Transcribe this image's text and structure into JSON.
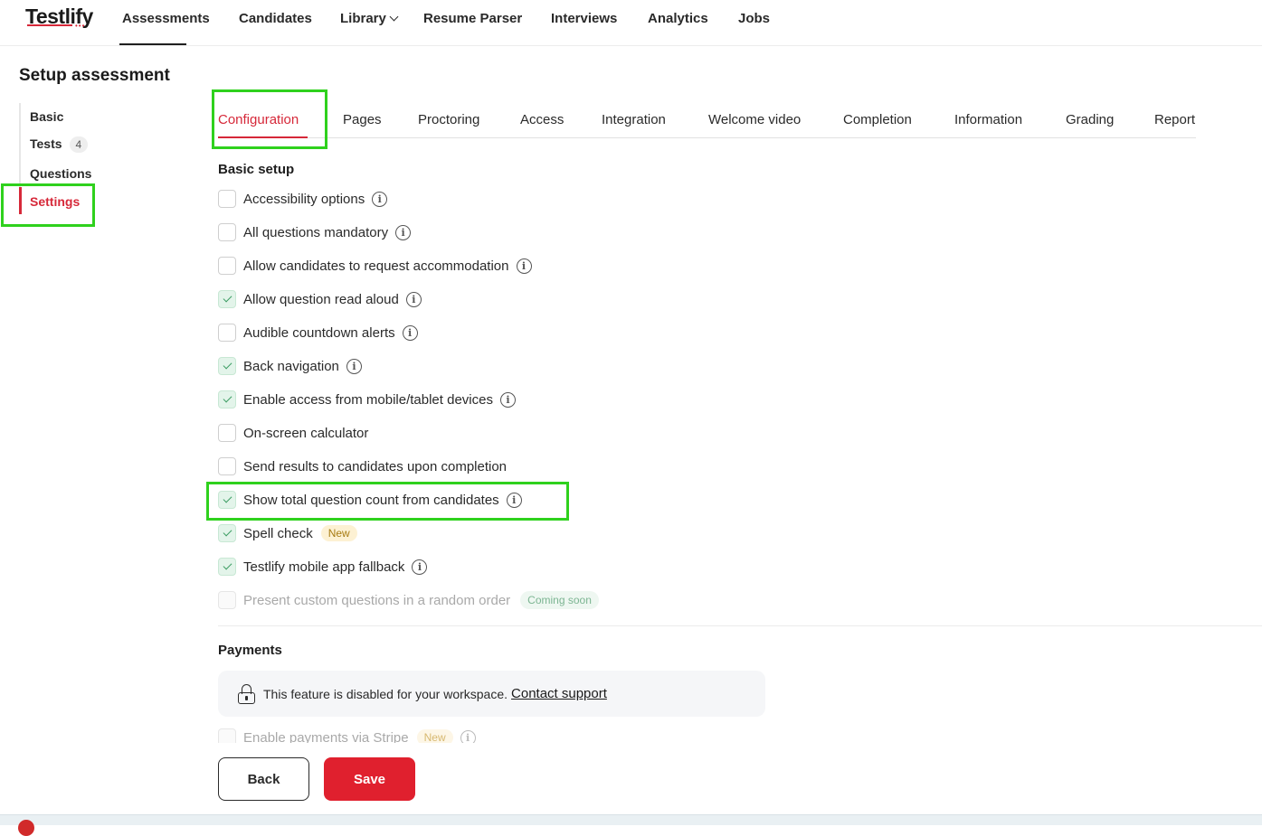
{
  "brand": {
    "logo": "Testlify",
    "logo_dots": "•••"
  },
  "nav": {
    "assessments": "Assessments",
    "candidates": "Candidates",
    "library": "Library",
    "resume_parser": "Resume Parser",
    "interviews": "Interviews",
    "analytics": "Analytics",
    "jobs": "Jobs"
  },
  "page": {
    "title": "Setup assessment"
  },
  "sidebar": {
    "basic": "Basic",
    "tests": "Tests",
    "tests_count": "4",
    "questions": "Questions",
    "settings": "Settings"
  },
  "tabs": {
    "configuration": "Configuration",
    "pages": "Pages",
    "proctoring": "Proctoring",
    "access": "Access",
    "integration": "Integration",
    "welcome_video": "Welcome video",
    "completion": "Completion",
    "information": "Information",
    "grading": "Grading",
    "report": "Report"
  },
  "basic_setup": {
    "title": "Basic setup",
    "options": [
      {
        "label": "Accessibility options",
        "checked": false
      },
      {
        "label": "All questions mandatory",
        "checked": false
      },
      {
        "label": "Allow candidates to request accommodation",
        "checked": false
      },
      {
        "label": "Allow question read aloud",
        "checked": true
      },
      {
        "label": "Audible countdown alerts",
        "checked": false
      },
      {
        "label": "Back navigation",
        "checked": true
      },
      {
        "label": "Enable access from mobile/tablet devices",
        "checked": true
      },
      {
        "label": "On-screen calculator",
        "checked": false
      },
      {
        "label": "Send results to candidates upon completion",
        "checked": false
      },
      {
        "label": "Show total question count from candidates",
        "checked": true
      },
      {
        "label": "Spell check",
        "checked": true,
        "badge": "New"
      },
      {
        "label": "Testlify mobile app fallback",
        "checked": true
      },
      {
        "label": "Present custom questions in a random order",
        "checked": false,
        "disabled": true,
        "badge": "Coming soon"
      }
    ]
  },
  "payments": {
    "title": "Payments",
    "notice_text": "This feature is disabled for your workspace.",
    "notice_link": "Contact support",
    "stripe_label": "Enable payments via Stripe",
    "stripe_badge": "New"
  },
  "actions": {
    "back": "Back",
    "save": "Save"
  },
  "colors": {
    "accent": "#d62839",
    "save": "#e0202e",
    "highlight": "#2fd11d",
    "check": "#3a9c61"
  }
}
